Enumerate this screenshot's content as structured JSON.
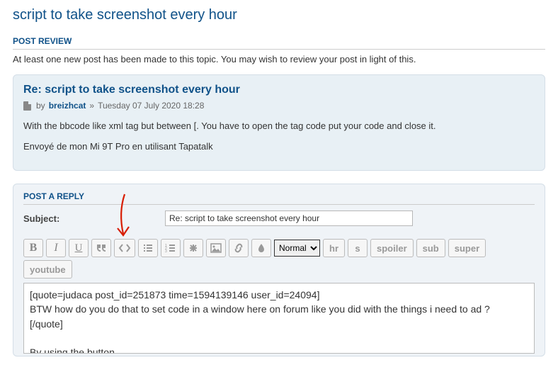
{
  "page": {
    "title": "script to take screenshot every hour"
  },
  "review": {
    "heading": "POST REVIEW",
    "notice": "At least one new post has been made to this topic. You may wish to review your post in light of this."
  },
  "post": {
    "title": "Re: script to take screenshot every hour",
    "by_label": "by",
    "author": "breizhcat",
    "sep": "»",
    "date": "Tuesday 07 July 2020 18:28",
    "body_line1": "With the bbcode like xml tag but between [. You have to open the tag code put your code and close it.",
    "body_line2": "Envoyé de mon Mi 9T Pro en utilisant Tapatalk"
  },
  "reply": {
    "heading": "POST A REPLY",
    "subject_label": "Subject:",
    "subject_value": "Re: script to take screenshot every hour",
    "font_size": "Normal",
    "editor_text": "[quote=judaca post_id=251873 time=1594139146 user_id=24094]\nBTW how do you do that to set code in a window here on forum like you did with the things i need to ad ?\n[/quote]\n\nBy using the button"
  },
  "toolbar": {
    "bold": "B",
    "italic": "I",
    "underline": "U",
    "hr": "hr",
    "s": "s",
    "spoiler": "spoiler",
    "sub": "sub",
    "super": "super",
    "youtube": "youtube"
  }
}
